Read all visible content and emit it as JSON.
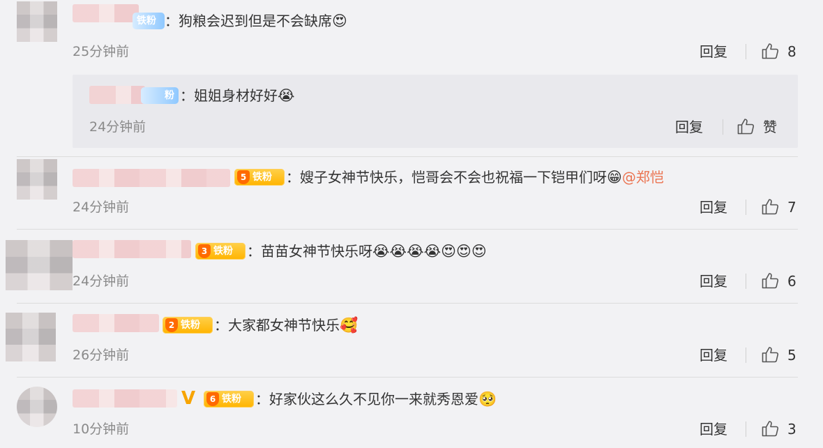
{
  "comments": [
    {
      "text": "：狗粮会迟到但是不会缺席",
      "emoji": "😍",
      "time": "25分钟前",
      "reply_label": "回复",
      "likes": "8",
      "badge_text": "铁粉"
    },
    {
      "text": "：嫂子女神节快乐，恺哥会不会也祝福一下铠甲们呀",
      "emoji": "😁",
      "mention": "@郑恺",
      "time": "24分钟前",
      "reply_label": "回复",
      "likes": "7",
      "badge_level": "5",
      "badge_text": "铁粉"
    },
    {
      "text": "：苗苗女神节快乐呀",
      "emoji": "😭😭😭😭😍😍😍",
      "time": "24分钟前",
      "reply_label": "回复",
      "likes": "6",
      "badge_level": "3",
      "badge_text": "铁粉"
    },
    {
      "text": "：大家都女神节快乐",
      "emoji": "🥰",
      "time": "26分钟前",
      "reply_label": "回复",
      "likes": "5",
      "badge_level": "2",
      "badge_text": "铁粉"
    },
    {
      "text": "：好家伙这么久不见你一来就秀恩爱",
      "emoji": "🥺",
      "time": "10分钟前",
      "reply_label": "回复",
      "likes": "3",
      "badge_level": "6",
      "badge_text": "铁粉",
      "vip": "V"
    }
  ],
  "sub_reply": {
    "text": "：姐姐身材好好",
    "emoji": "😭",
    "time": "24分钟前",
    "reply_label": "回复",
    "like_label": "赞",
    "badge_text": "粉"
  },
  "colors": {
    "background": "#f2f2f4",
    "mention": "#eb7350",
    "badge": "#ffb400"
  },
  "icons": {
    "like": "thumbs-up-icon"
  }
}
